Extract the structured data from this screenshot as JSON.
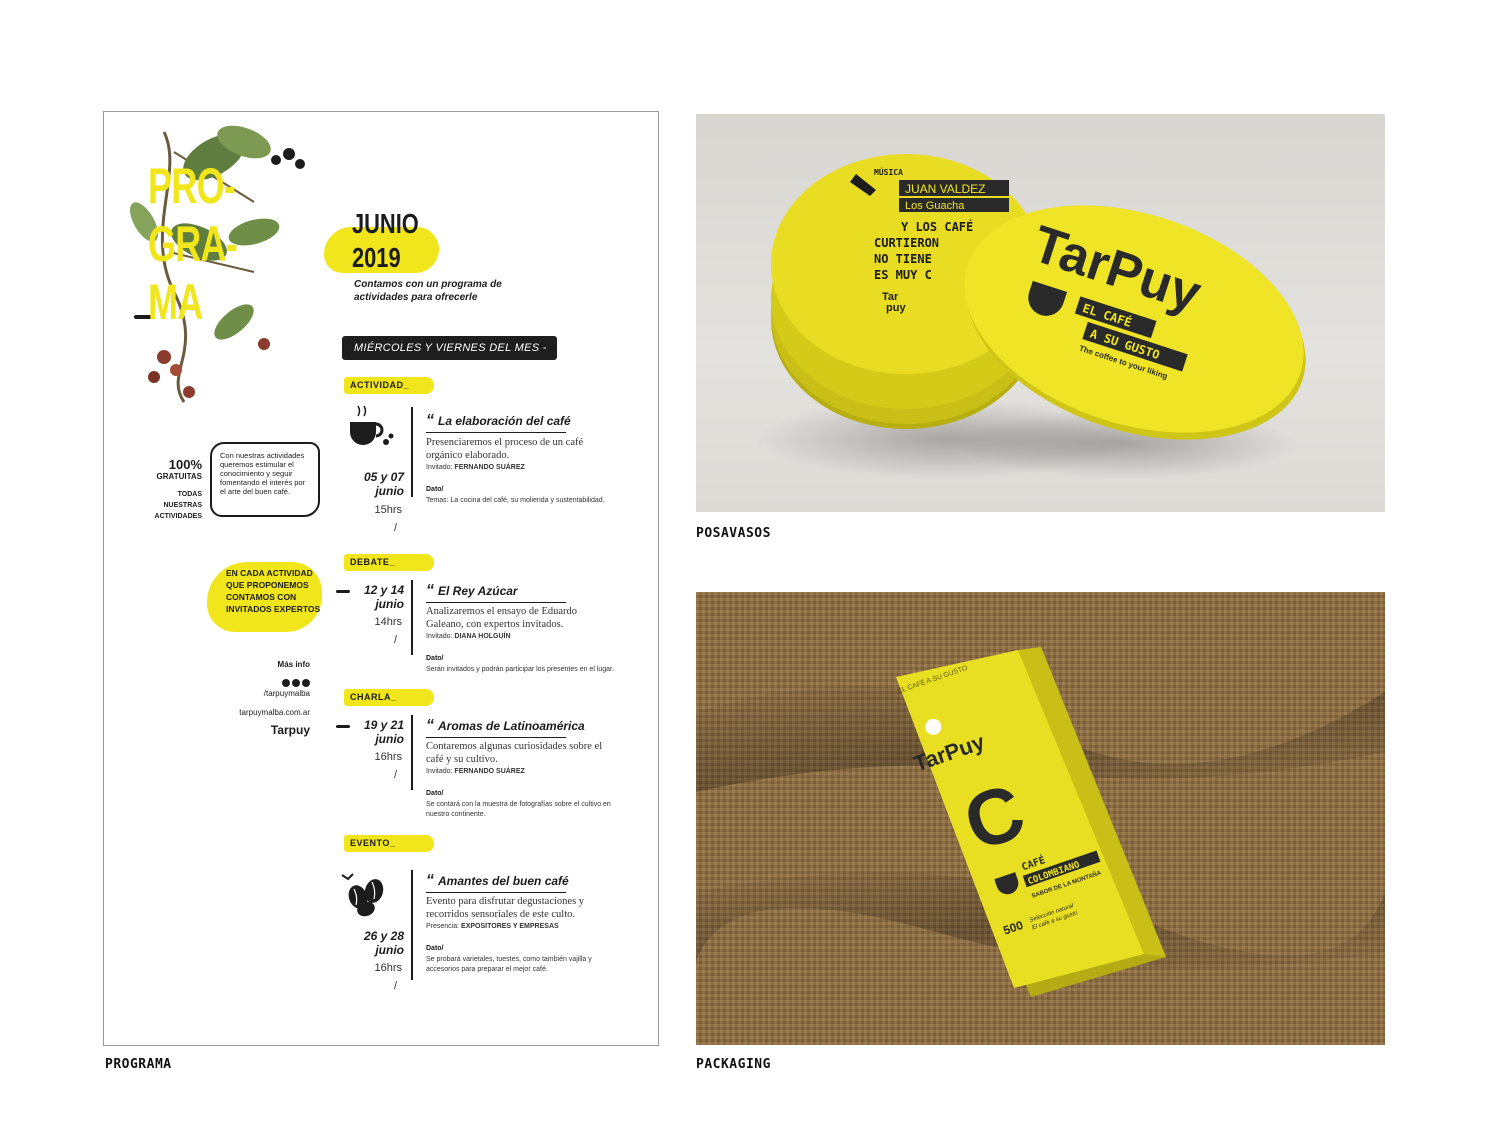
{
  "captions": {
    "programa": "PROGRAMA",
    "posavasos": "POSAVASOS",
    "packaging": "PACKAGING"
  },
  "poster": {
    "title_lines": [
      "PRO-",
      "GRA-",
      "MA"
    ],
    "month": "JUNIO",
    "year": "2019",
    "intro": "Contamos con un programa de actividades para ofrecerle",
    "days": "MIÉRCOLES Y VIERNES DEL MES -",
    "free_pct": "100%",
    "free_label": "GRATUITAS",
    "free_sub": "TODAS NUESTRAS ACTIVIDADES",
    "bubble": "Con nuestras actividades queremos estimular el conocimiento y seguir fomentando el interés por el arte del buen café.",
    "experts": "EN CADA ACTIVIDAD QUE PROPONEMOS CONTAMOS CON INVITADOS EXPERTOS",
    "more_info": "Más info",
    "social_handle": "/tarpuymalba",
    "website": "tarpuymalba.com.ar",
    "brand": "Tarpuy",
    "events": [
      {
        "tag": "ACTIVIDAD_",
        "title": "La elaboración del café",
        "desc": "Presenciaremos el proceso de un café orgánico elaborado.",
        "guest_label": "Invitado:",
        "guest": "FERNANDO SUÁREZ",
        "dato_label": "Dato/",
        "dato": "Temas: La cocina del café, su molienda y sustentabilidad.",
        "date": "05 y 07",
        "month": "junio",
        "time": "15hrs"
      },
      {
        "tag": "DEBATE_",
        "title": "El Rey Azúcar",
        "desc": "Analizaremos el ensayo de Eduardo Galeano, con expertos invitados.",
        "guest_label": "Invitado:",
        "guest": "DIANA HOLGUÍN",
        "dato_label": "Dato/",
        "dato": "Serán invitados y podrán participar los presentes en el lugar.",
        "date": "12 y 14",
        "month": "junio",
        "time": "14hrs"
      },
      {
        "tag": "CHARLA_",
        "title": "Aromas de Latinoamérica",
        "desc": "Contaremos algunas curiosidades sobre el café y su cultivo.",
        "guest_label": "Invitado:",
        "guest": "FERNANDO SUÁREZ",
        "dato_label": "Dato/",
        "dato": "Se contará con la muestra de fotografías sobre el cultivo en nuestro continente.",
        "date": "19 y 21",
        "month": "junio",
        "time": "16hrs"
      },
      {
        "tag": "EVENTO_",
        "title": "Amantes del buen café",
        "desc": "Evento para disfrutar degustaciones y recorridos sensoriales de este culto.",
        "guest_label": "Presencia:",
        "guest": "EXPOSITORES Y EMPRESAS",
        "dato_label": "Dato/",
        "dato": "Se probará varietales, tuestes, como también vajilla y accesorios para preparar el mejor café.",
        "date": "26 y 28",
        "month": "junio",
        "time": "16hrs"
      }
    ]
  },
  "coaster_back": {
    "music_label": "MÚSICA",
    "band_1": "JUAN VALDEZ",
    "band_2": "Los Guacha",
    "quote_1": "Y LOS CAFÉ",
    "quote_2": "CURTIERON",
    "quote_3": "NO TIENE",
    "quote_4": "ES MUY C",
    "logo_1": "Tar",
    "logo_2": "puy"
  },
  "coaster_front": {
    "brand": "TarPuy",
    "slogan_1": "EL CAFÉ",
    "slogan_2": "A SU GUSTO",
    "slogan_en": "The coffee to your liking"
  },
  "bag": {
    "top_text": "EL CAFÉ A SU GUSTO",
    "brand": "TarPuy",
    "letter": "C",
    "product_1": "CAFÉ",
    "product_2": "COLOMBIANO",
    "flavor": "SABOR DE LA MONTAÑA",
    "selection_1": "Selección natural",
    "selection_2": "El café a su gusto",
    "weight": "500"
  },
  "colors": {
    "brand_yellow": "#f1e61c",
    "ink": "#1c1c1c",
    "burlap": "#8a6c44"
  }
}
